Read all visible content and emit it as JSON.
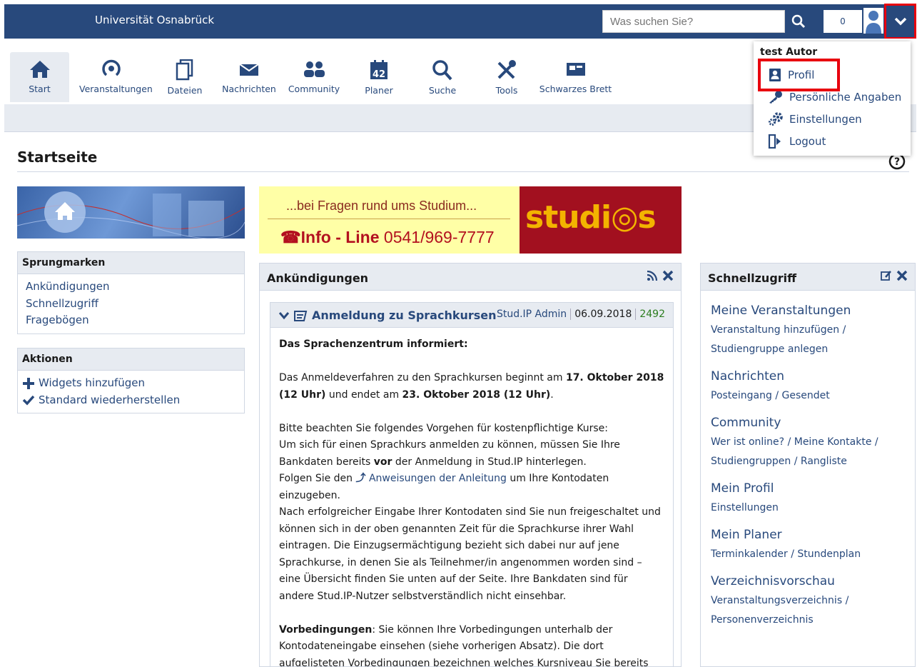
{
  "topbar": {
    "title": "Universität Osnabrück",
    "search_placeholder": "Was suchen Sie?",
    "counter": "0"
  },
  "nav": [
    {
      "label": "Start",
      "icon": "home-icon"
    },
    {
      "label": "Veranstaltungen",
      "icon": "seminar-icon"
    },
    {
      "label": "Dateien",
      "icon": "files-icon"
    },
    {
      "label": "Nachrichten",
      "icon": "mail-icon"
    },
    {
      "label": "Community",
      "icon": "community-icon"
    },
    {
      "label": "Planer",
      "icon": "calendar-icon"
    },
    {
      "label": "Suche",
      "icon": "search-icon"
    },
    {
      "label": "Tools",
      "icon": "tools-icon"
    },
    {
      "label": "Schwarzes Brett",
      "icon": "blackboard-icon"
    }
  ],
  "page": {
    "title": "Startseite"
  },
  "sidebar": {
    "jump": {
      "title": "Sprungmarken",
      "items": [
        "Ankündigungen",
        "Schnellzugriff",
        "Fragebögen"
      ]
    },
    "actions": {
      "title": "Aktionen",
      "items": [
        "Widgets hinzufügen",
        "Standard wiederherstellen"
      ]
    }
  },
  "banner": {
    "question": "...bei Fragen rund ums Studium...",
    "info_prefix": "Info - Line",
    "info_number": "0541/969-7777",
    "logo": "studi◎s"
  },
  "announcements": {
    "title": "Ankündigungen",
    "news": {
      "title": "Anmeldung zu Sprachkursen",
      "author": "Stud.IP Admin",
      "date": "06.09.2018",
      "views": "2492",
      "lead": "Das Sprachenzentrum informiert:",
      "p1_a": "Das Anmeldeverfahren zu den Sprachkursen beginnt am ",
      "p1_b": "17. Oktober 2018 (12 Uhr)",
      "p1_c": " und endet am ",
      "p1_d": "23. Oktober 2018 (12 Uhr)",
      "p1_e": ".",
      "p2_a": "Bitte beachten Sie folgendes Vorgehen für kostenpflichtige Kurse:",
      "p2_b": "Um sich für einen Sprachkurs anmelden zu können, müssen Sie Ihre Bankdaten bereits ",
      "p2_c": "vor",
      "p2_d": " der Anmeldung in Stud.IP hinterlegen.",
      "p2_e": "Folgen Sie den ",
      "p2_link": "Anweisungen der Anleitung",
      "p2_f": " um Ihre Kontodaten einzugeben.",
      "p2_g": "Nach erfolgreicher Eingabe Ihrer Kontodaten sind Sie nun freigeschaltet und können sich in der oben genannten Zeit für die Sprachkurse ihrer Wahl eintragen. Die Einzugsermächtigung bezieht sich dabei nur auf jene Sprachkurse, in denen Sie als Teilnehmer/in angenommen worden sind – eine Übersicht finden Sie unten auf der Seite. Ihre Bankdaten sind für andere Stud.IP-Nutzer selbstverständlich nicht einsehbar.",
      "p3_a": "Vorbedingungen",
      "p3_b": ": Sie können Ihre Vorbedingungen unterhalb der Kontodateneingabe einsehen (siehe vorherigen Absatz). Die dort aufgelisteten Vorbedingungen bezeichnen welches Kursniveau Sie bereits"
    }
  },
  "quick": {
    "title": "Schnellzugriff",
    "sections": [
      {
        "title": "Meine Veranstaltungen",
        "l1": "Veranstaltung hinzufügen",
        "l2": "Studiengruppe anlegen"
      },
      {
        "title": "Nachrichten",
        "l1": "Posteingang",
        "l2": "Gesendet"
      },
      {
        "title": "Community",
        "l1": "Wer ist online?",
        "l2": "Meine Kontakte",
        "l3": "Studiengruppen",
        "l4": "Rangliste"
      },
      {
        "title": "Mein Profil",
        "l1": "Einstellungen"
      },
      {
        "title": "Mein Planer",
        "l1": "Terminkalender",
        "l2": "Stundenplan"
      },
      {
        "title": "Verzeichnisvorschau",
        "l1": "Veranstaltungsverzeichnis",
        "l2": "Personenverzeichnis"
      }
    ]
  },
  "dropdown": {
    "username": "test Autor",
    "items": [
      "Profil",
      "Persönliche Angaben",
      "Einstellungen",
      "Logout"
    ]
  }
}
